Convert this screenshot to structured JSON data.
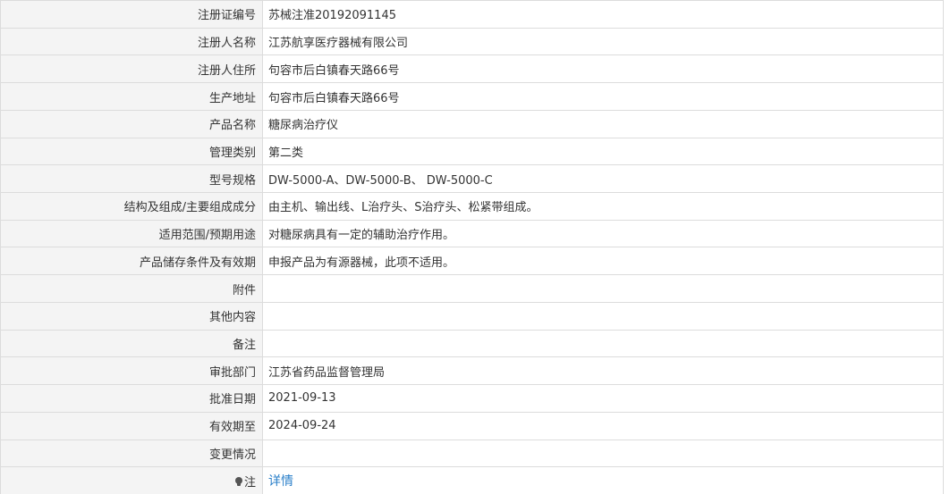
{
  "fields": [
    {
      "label": "注册证编号",
      "value": "苏械注准20192091145"
    },
    {
      "label": "注册人名称",
      "value": "江苏航享医疗器械有限公司"
    },
    {
      "label": "注册人住所",
      "value": "句容市后白镇春天路66号"
    },
    {
      "label": "生产地址",
      "value": "句容市后白镇春天路66号"
    },
    {
      "label": "产品名称",
      "value": "糖尿病治疗仪"
    },
    {
      "label": "管理类别",
      "value": "第二类"
    },
    {
      "label": "型号规格",
      "value": "DW-5000-A、DW-5000-B、 DW-5000-C"
    },
    {
      "label": "结构及组成/主要组成成分",
      "value": "由主机、输出线、L治疗头、S治疗头、松紧带组成。"
    },
    {
      "label": "适用范围/预期用途",
      "value": "对糖尿病具有一定的辅助治疗作用。"
    },
    {
      "label": "产品储存条件及有效期",
      "value": "申报产品为有源器械，此项不适用。"
    },
    {
      "label": "附件",
      "value": ""
    },
    {
      "label": "其他内容",
      "value": ""
    },
    {
      "label": "备注",
      "value": ""
    },
    {
      "label": "审批部门",
      "value": "江苏省药品监督管理局"
    },
    {
      "label": "批准日期",
      "value": "2021-09-13"
    },
    {
      "label": "有效期至",
      "value": "2024-09-24"
    },
    {
      "label": "变更情况",
      "value": ""
    }
  ],
  "note": {
    "icon": "lightbulb-icon",
    "label": "注",
    "link_text": "详情"
  }
}
